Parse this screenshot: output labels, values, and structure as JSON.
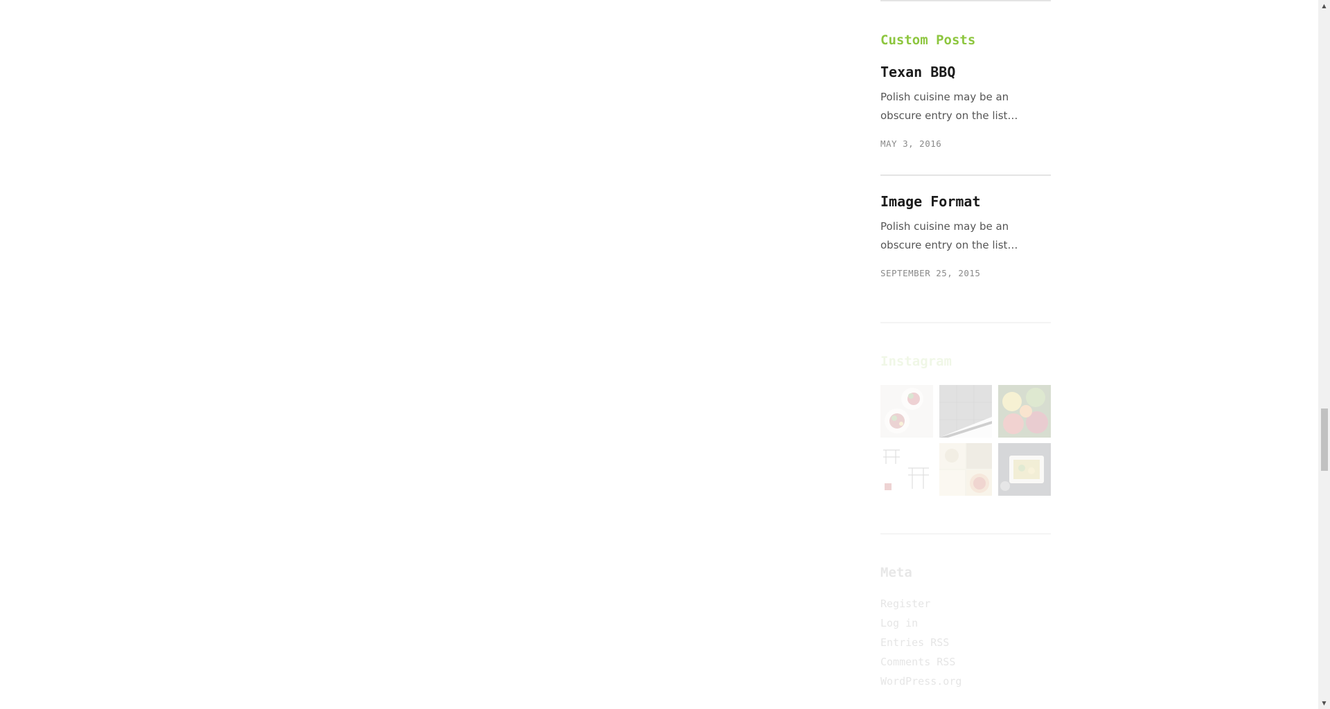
{
  "custom_posts": {
    "title": "Custom Posts",
    "posts": [
      {
        "title": "Texan BBQ",
        "excerpt": "Polish cuisine may be an obscure entry on the list…",
        "date": "MAY 3, 2016"
      },
      {
        "title": "Image Format",
        "excerpt": "Polish cuisine may be an obscure entry on the list…",
        "date": "SEPTEMBER 25, 2015"
      }
    ]
  },
  "instagram": {
    "title": "Instagram",
    "thumbnails": [
      "salad-bowls",
      "kitchen-tiles",
      "fruit-vegetables",
      "interior-sketch",
      "pizza-collage",
      "food-tray"
    ]
  },
  "meta": {
    "title": "Meta",
    "links": [
      "Register",
      "Log in",
      "Entries RSS",
      "Comments RSS",
      "WordPress.org"
    ]
  },
  "colors": {
    "accent": "#8dc63f",
    "text": "#1b1b1b",
    "muted": "#8a8a8a",
    "divider": "#e4e4e4"
  },
  "scrollbar": {
    "up_icon": "arrow-up-icon",
    "down_icon": "arrow-down-icon"
  }
}
